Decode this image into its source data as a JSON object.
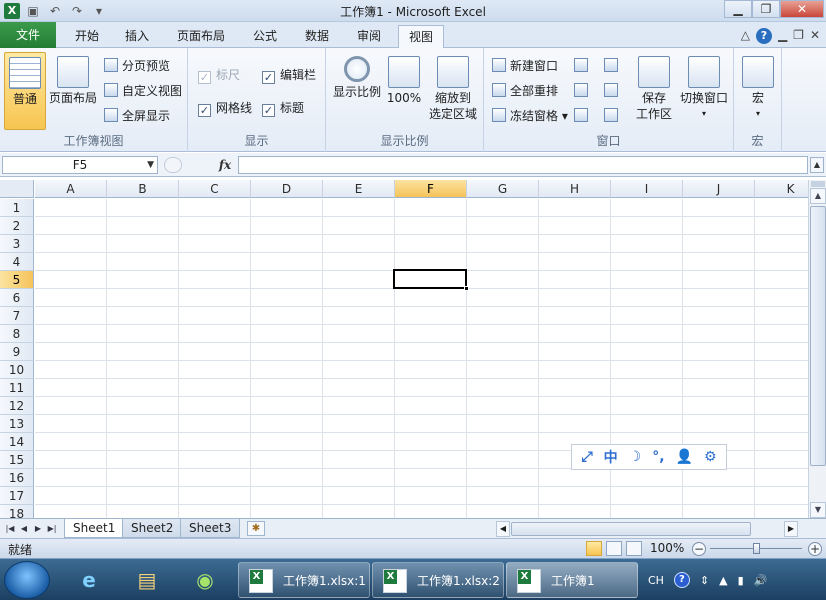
{
  "window": {
    "title": "工作簿1 - Microsoft Excel",
    "minimize": "▁",
    "maximize": "❐",
    "close": "✕"
  },
  "qat": {
    "logo": "X",
    "save_icon": "save-icon",
    "undo": "↶",
    "redo": "↷",
    "customize": "▾"
  },
  "tabs": [
    {
      "label": "文件"
    },
    {
      "label": "开始"
    },
    {
      "label": "插入"
    },
    {
      "label": "页面布局"
    },
    {
      "label": "公式"
    },
    {
      "label": "数据"
    },
    {
      "label": "审阅"
    },
    {
      "label": "视图"
    }
  ],
  "active_tab": "视图",
  "tab_tools": {
    "collapse": "△",
    "help": "?",
    "min": "▁",
    "restore": "❐",
    "close": "✕"
  },
  "ribbon": {
    "workbook_views": {
      "label": "工作簿视图",
      "normal": "普通",
      "page_layout": "页面布局",
      "page_break": "分页预览",
      "custom_views": "自定义视图",
      "full_screen": "全屏显示"
    },
    "show": {
      "label": "显示",
      "ruler": "标尺",
      "formula_bar": "编辑栏",
      "gridlines": "网格线",
      "headings": "标题"
    },
    "zoom": {
      "label": "显示比例",
      "zoom": "显示比例",
      "hundred": "100%",
      "zoom_selection_1": "缩放到",
      "zoom_selection_2": "选定区域"
    },
    "window": {
      "label": "窗口",
      "new_window": "新建窗口",
      "arrange_all": "全部重排",
      "freeze_panes": "冻结窗格",
      "save_workspace_1": "保存",
      "save_workspace_2": "工作区",
      "switch_windows": "切换窗口"
    },
    "macros": {
      "label": "宏",
      "macros": "宏"
    }
  },
  "formula_bar": {
    "name_box": "F5",
    "fx": "fx",
    "formula": ""
  },
  "grid": {
    "columns": [
      "A",
      "B",
      "C",
      "D",
      "E",
      "F",
      "G",
      "H",
      "I",
      "J",
      "K"
    ],
    "rows": [
      "1",
      "2",
      "3",
      "4",
      "5",
      "6",
      "7",
      "8",
      "9",
      "10",
      "11",
      "12",
      "13",
      "14",
      "15",
      "16",
      "17",
      "18"
    ],
    "selected_column": "F",
    "selected_row": "5"
  },
  "ime": {
    "items": [
      "⤢",
      "中",
      "☽",
      "°,",
      "👤",
      "⚙"
    ]
  },
  "sheets": [
    "Sheet1",
    "Sheet2",
    "Sheet3"
  ],
  "active_sheet": "Sheet1",
  "status": {
    "text": "就绪",
    "zoom": "100%",
    "minus": "−",
    "plus": "+"
  },
  "taskbar": {
    "tasks": [
      "工作簿1.xlsx:1",
      "工作簿1.xlsx:2",
      "工作簿1"
    ],
    "tray": {
      "lang": "CH",
      "help": "?"
    }
  }
}
